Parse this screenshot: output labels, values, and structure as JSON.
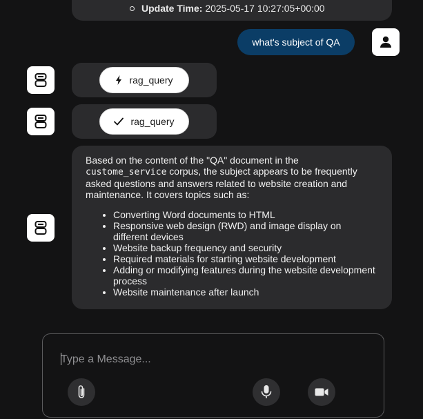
{
  "previous_message": {
    "items": [
      {
        "label": "Update Time:",
        "value": "2025-05-17 10:27:05+00:00"
      }
    ]
  },
  "user_message": {
    "text": "what's subject of QA"
  },
  "tool_calls": [
    {
      "name": "rag_query",
      "state": "running",
      "icon": "bolt-icon"
    },
    {
      "name": "rag_query",
      "state": "done",
      "icon": "check-icon"
    }
  ],
  "assistant_message": {
    "intro_before": "Based on the content of the \"QA\" document in the",
    "code": "custome_service",
    "intro_after": " corpus, the subject appears to be frequently asked questions and answers related to website creation and maintenance. It covers topics such as:",
    "topics": [
      "Converting Word documents to HTML",
      "Responsive web design (RWD) and image display on different devices",
      "Website backup frequency and security",
      "Required materials for starting website development",
      "Adding or modifying features during the website development process",
      "Website maintenance after launch"
    ]
  },
  "composer": {
    "placeholder": "Type a Message...",
    "buttons": {
      "attach": "paperclip-icon",
      "mic": "microphone-icon",
      "camera": "video-camera-icon"
    }
  },
  "colors": {
    "background": "#131314",
    "bubble": "#2b2b2d",
    "user_bubble": "#0b3d66",
    "pill": "#ffffff"
  }
}
